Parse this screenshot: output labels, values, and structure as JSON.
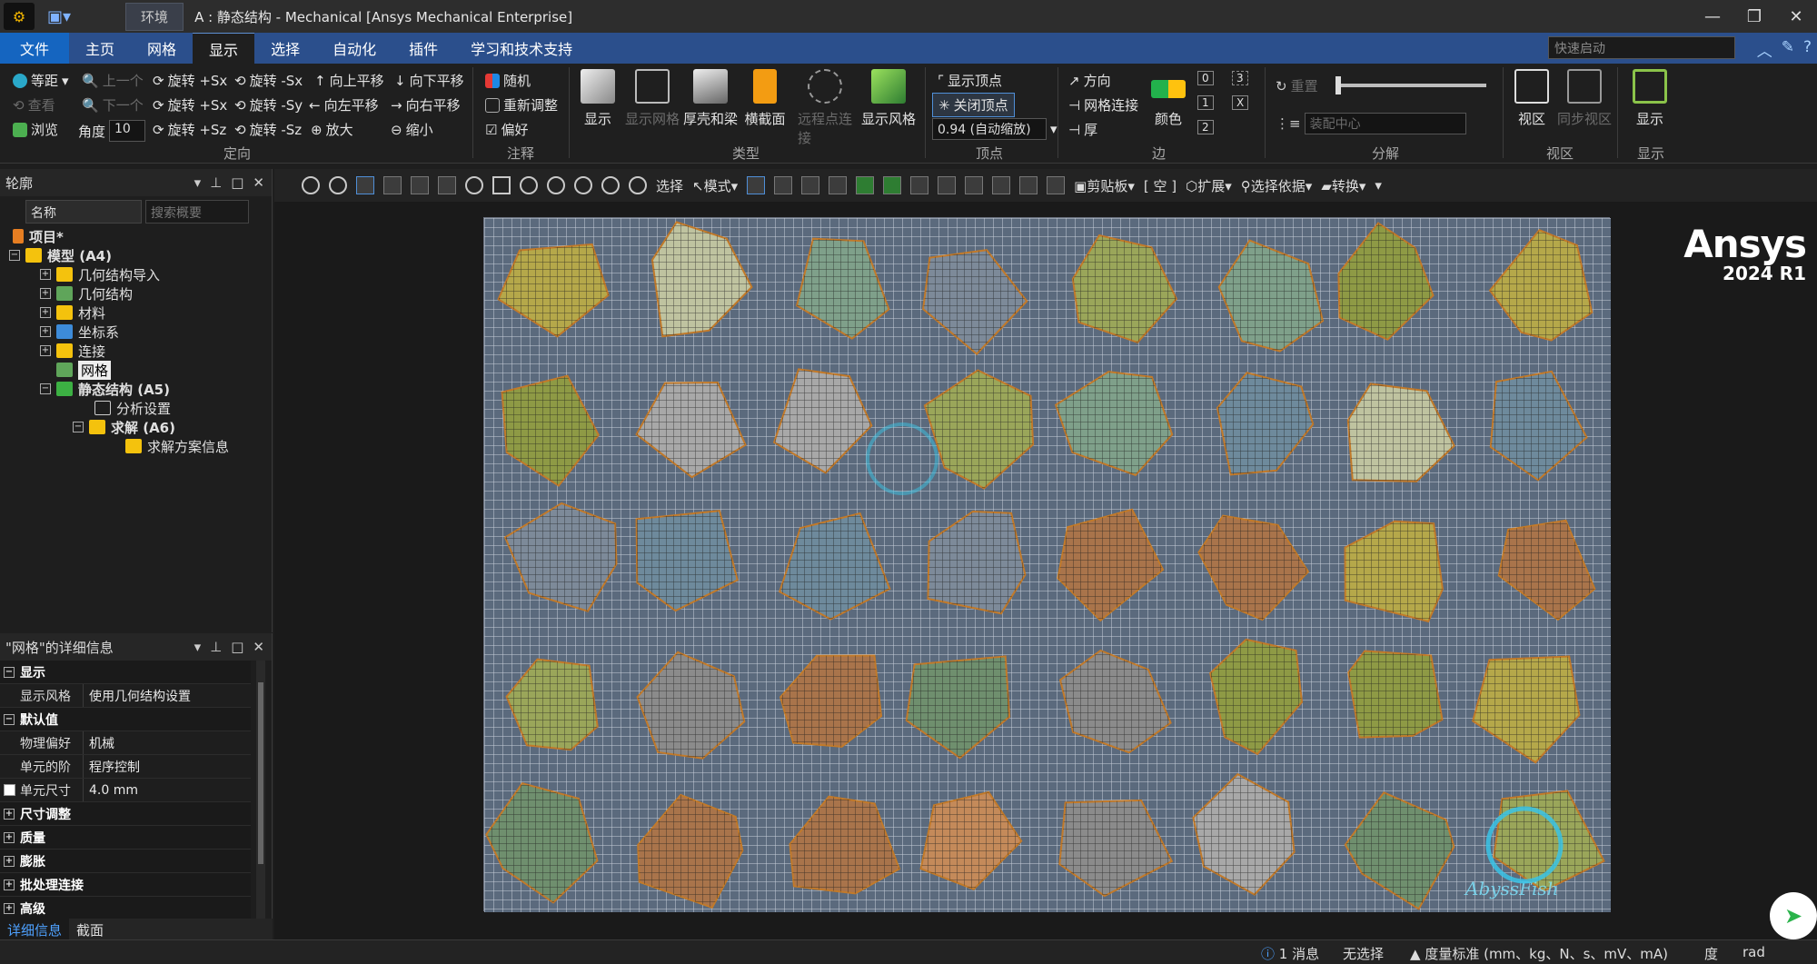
{
  "titlebar": {
    "context_tab": "环境",
    "title": "A : 静态结构 - Mechanical [Ansys Mechanical Enterprise]"
  },
  "menu": {
    "file": "文件",
    "tabs": [
      "主页",
      "网格",
      "显示",
      "选择",
      "自动化",
      "插件",
      "学习和技术支持"
    ],
    "active": "显示",
    "quick_launch_placeholder": "快速启动"
  },
  "ribbon": {
    "orient": {
      "iso": "等距",
      "prev": "上一个",
      "next": "下一个",
      "look": "查看",
      "browse": "浏览",
      "angle_label": "角度",
      "angle_value": "10",
      "rot_px": "旋转 +Sx",
      "rot_mx": "旋转 -Sx",
      "rot_py": "旋转 +Sx",
      "rot_my": "旋转 -Sy",
      "rot_pz": "旋转 +Sz",
      "rot_mz": "旋转 -Sz",
      "pan_up": "向上平移",
      "pan_down": "向下平移",
      "pan_left": "向左平移",
      "pan_right": "向右平移",
      "zoom_in": "放大",
      "zoom_out": "缩小",
      "group": "定向"
    },
    "annot": {
      "random": "随机",
      "readjust": "重新调整",
      "pref": "偏好",
      "group": "注释"
    },
    "type": {
      "display": "显示",
      "show_mesh": "显示网格",
      "shell_beam": "厚壳和梁",
      "cross_section": "横截面",
      "remote_pt": "远程点连接",
      "display_style": "显示风格",
      "group": "类型"
    },
    "vertex": {
      "show_vertex": "显示顶点",
      "close_vertex": "关闭顶点",
      "scale": "0.94 (自动缩放)",
      "group": "顶点"
    },
    "edge": {
      "direction": "方向",
      "mesh_conn": "网格连接",
      "thick": "厚",
      "color": "颜色",
      "n0": "0",
      "n1": "1",
      "n2": "2",
      "n3": "3",
      "nx": "X",
      "group": "边"
    },
    "explode": {
      "reset": "重置",
      "assembly_center": "装配中心",
      "group": "分解"
    },
    "viewport": {
      "view": "视区",
      "sync": "同步视区",
      "group": "视区"
    },
    "disp": {
      "display": "显示",
      "group": "显示"
    }
  },
  "outline": {
    "title": "轮廓",
    "filter": "名称",
    "search_placeholder": "搜索概要",
    "tree": [
      {
        "label": "项目*"
      },
      {
        "label": "模型 (A4)"
      },
      {
        "label": "几何结构导入"
      },
      {
        "label": "几何结构"
      },
      {
        "label": "材料"
      },
      {
        "label": "坐标系"
      },
      {
        "label": "连接"
      },
      {
        "label": "网格"
      },
      {
        "label": "静态结构 (A5)"
      },
      {
        "label": "分析设置"
      },
      {
        "label": "求解 (A6)"
      },
      {
        "label": "求解方案信息"
      }
    ]
  },
  "details": {
    "title": "\"网格\"的详细信息",
    "rows": [
      {
        "k": "显示"
      },
      {
        "k": "显示风格",
        "v": "使用几何结构设置"
      },
      {
        "k": "默认值"
      },
      {
        "k": "物理偏好",
        "v": "机械"
      },
      {
        "k": "单元的阶",
        "v": "程序控制"
      },
      {
        "k": "单元尺寸",
        "v": "4.0 mm"
      },
      {
        "k": "尺寸调整"
      },
      {
        "k": "质量"
      },
      {
        "k": "膨胀"
      },
      {
        "k": "批处理连接"
      },
      {
        "k": "高级"
      }
    ],
    "tabs": [
      "详细信息",
      "截面"
    ]
  },
  "graphics": {
    "select": "选择",
    "mode": "模式",
    "clipboard": "剪贴板",
    "empty": "[ 空 ]",
    "extend": "扩展",
    "select_by": "选择依据",
    "convert": "转换",
    "brand": "Ansys",
    "version": "2024 R1",
    "watermark": "AbyssFish"
  },
  "status": {
    "messages": "1 消息",
    "selection": "无选择",
    "units": "度量标准 (mm、kg、N、s、mV、mA)",
    "deg": "度",
    "rad": "rad"
  }
}
